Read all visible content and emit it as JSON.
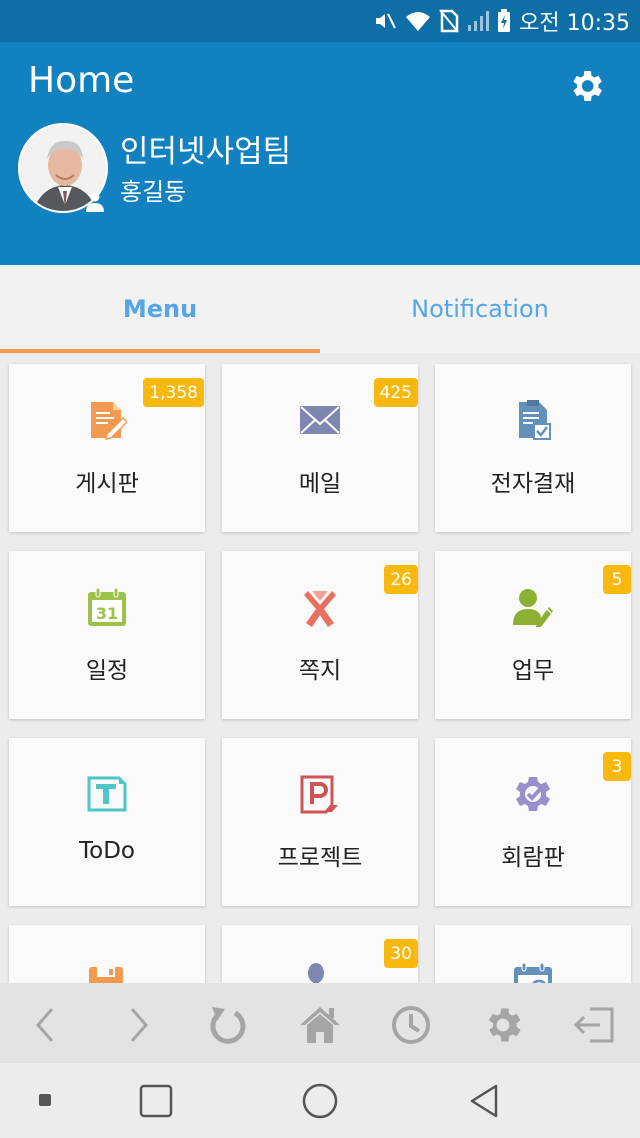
{
  "status_bar": {
    "time": "오전 10:35",
    "icons": [
      "mute-icon",
      "wifi-icon",
      "no-sim-icon",
      "signal-icon",
      "battery-icon"
    ]
  },
  "header": {
    "title": "Home",
    "settings_icon": "gear-icon",
    "department": "인터넷사업팀",
    "user_name": "홍길동",
    "bg_color": "#1281c0"
  },
  "tabs": [
    {
      "label": "Menu",
      "active": true
    },
    {
      "label": "Notification",
      "active": false
    }
  ],
  "menu": {
    "items": [
      {
        "label": "게시판",
        "icon": "board-icon",
        "badge": "1,358"
      },
      {
        "label": "메일",
        "icon": "mail-icon",
        "badge": "425"
      },
      {
        "label": "전자결재",
        "icon": "approval-icon",
        "badge": ""
      },
      {
        "label": "일정",
        "icon": "calendar-icon",
        "badge": ""
      },
      {
        "label": "쪽지",
        "icon": "memo-ribbon-icon",
        "badge": "26"
      },
      {
        "label": "업무",
        "icon": "task-person-icon",
        "badge": "5"
      },
      {
        "label": "ToDo",
        "icon": "todo-icon",
        "badge": ""
      },
      {
        "label": "프로젝트",
        "icon": "project-icon",
        "badge": ""
      },
      {
        "label": "회람판",
        "icon": "circulation-gear-icon",
        "badge": "3"
      },
      {
        "label": "",
        "icon": "save-disk-icon",
        "badge": ""
      },
      {
        "label": "",
        "icon": "person-doc-icon",
        "badge": "30"
      },
      {
        "label": "",
        "icon": "schedule-icon",
        "badge": ""
      }
    ],
    "badge_color": "#f8b80e"
  },
  "toolbar": {
    "icons": [
      "back-icon",
      "forward-icon",
      "refresh-icon",
      "home-icon",
      "history-icon",
      "settings-icon",
      "logout-icon"
    ]
  },
  "navbar": {
    "icons": [
      "dot-icon",
      "recent-apps-icon",
      "home-circle-icon",
      "back-triangle-icon"
    ]
  }
}
